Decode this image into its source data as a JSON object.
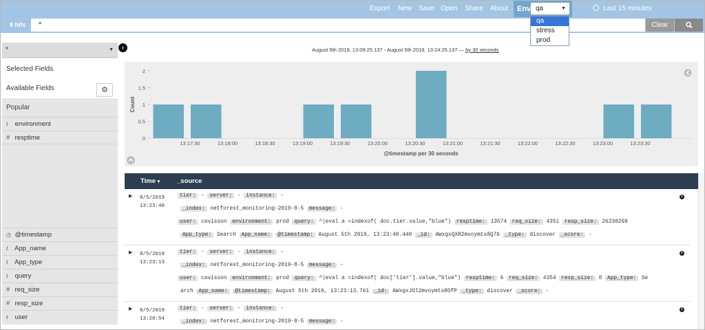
{
  "topnav": {
    "items": [
      "Export",
      "New",
      "Save",
      "Open",
      "Share",
      "About"
    ],
    "env_tab_label": "Env",
    "env_selected": "qa",
    "env_options": [
      "qa",
      "stress",
      "prod"
    ],
    "time_label": "Last 15 minutes"
  },
  "search": {
    "hits": "8 hits",
    "query": "*",
    "clear_label": "Clear"
  },
  "sidebar": {
    "index_pattern": "*",
    "selected_fields_label": "Selected Fields",
    "available_fields_label": "Available Fields",
    "popular_label": "Popular",
    "popular_fields": [
      {
        "type": "t",
        "name": "environment"
      },
      {
        "type": "#",
        "name": "resptime"
      }
    ],
    "fields": [
      {
        "type": "clock",
        "name": "@timestamp"
      },
      {
        "type": "t",
        "name": "App_name"
      },
      {
        "type": "t",
        "name": "App_type"
      },
      {
        "type": "t",
        "name": "query"
      },
      {
        "type": "#",
        "name": "req_size"
      },
      {
        "type": "#",
        "name": "resp_size"
      },
      {
        "type": "t",
        "name": "user"
      }
    ]
  },
  "range": {
    "text": "August 5th 2019, 13:09:25.137 - August 5th 2019, 13:24:25.137 —",
    "interval_link": "by 30 seconds"
  },
  "chart_data": {
    "type": "bar",
    "ylabel": "Count",
    "xlabel": "@timestamp per 30 seconds",
    "ylim": [
      0,
      2
    ],
    "yticks": [
      "0",
      "0.5",
      "1",
      "1.5",
      "2"
    ],
    "xticks": [
      "13:17:30",
      "13:18:00",
      "13:18:30",
      "13:19:00",
      "13:19:30",
      "13:20:00",
      "13:20:30",
      "13:21:00",
      "13:21:30",
      "13:22:00",
      "13:22:30",
      "13:23:00",
      "13:23:30"
    ],
    "bars": [
      {
        "x": "13:17:00",
        "value": 1
      },
      {
        "x": "13:17:30",
        "value": 1
      },
      {
        "x": "13:19:00",
        "value": 1
      },
      {
        "x": "13:19:30",
        "value": 1
      },
      {
        "x": "13:20:30",
        "value": 2
      },
      {
        "x": "13:23:00",
        "value": 1
      },
      {
        "x": "13:23:30",
        "value": 1
      }
    ],
    "color": "#6eacc2"
  },
  "table": {
    "col_time": "Time",
    "col_source": "_source",
    "rows": [
      {
        "date": "8/5/2019",
        "time": "13:23:40",
        "lines": [
          [
            [
              "tier:",
              "-"
            ],
            [
              "server:",
              "-"
            ],
            [
              "instance:",
              "-"
            ]
          ],
          [
            [
              "_index:",
              "netforest_monitoring-2019-8-5"
            ],
            [
              "message:",
              "-"
            ]
          ],
          [
            [
              "user:",
              "cavisson"
            ],
            [
              "environment:",
              "prod"
            ],
            [
              "query:",
              "^|eval a =indexof( doc.tier.value,\"blue\")"
            ],
            [
              "resptime:",
              "13574"
            ],
            [
              "req_size:",
              "4351"
            ],
            [
              "resp_size:",
              "26230269"
            ]
          ],
          [
            [
              "App_type:",
              "Search"
            ],
            [
              "App_name:",
              ""
            ],
            [
              "@timestamp:",
              "August 5th 2019, 13:23:40.440"
            ],
            [
              "_id:",
              "AWxgxQXR2mvoymts8Q76"
            ],
            [
              "_type:",
              "discover"
            ],
            [
              "_score:",
              "-"
            ]
          ]
        ]
      },
      {
        "date": "8/5/2019",
        "time": "13:23:13",
        "lines": [
          [
            [
              "tier:",
              "-"
            ],
            [
              "server:",
              "-"
            ],
            [
              "instance:",
              "-"
            ]
          ],
          [
            [
              "_index:",
              "netforest_monitoring-2019-8-5"
            ],
            [
              "message:",
              "-"
            ]
          ],
          [
            [
              "user:",
              "cavisson"
            ],
            [
              "environment:",
              "prod"
            ],
            [
              "query:",
              "^|eval a =indexof( doc['tier'].value,\"blue\")"
            ],
            [
              "resptime:",
              "6"
            ],
            [
              "req_size:",
              "4354"
            ],
            [
              "resp_size:",
              "0"
            ],
            [
              "App_type:",
              "Se"
            ]
          ],
          [
            [
              "",
              "arch"
            ],
            [
              "App_name:",
              ""
            ],
            [
              "@timestamp:",
              "August 5th 2019, 13:23:13.761"
            ],
            [
              "_id:",
              "AWxgxJOl2mvoymts8OfP"
            ],
            [
              "_type:",
              "discover"
            ],
            [
              "_score:",
              "-"
            ]
          ]
        ]
      },
      {
        "date": "8/5/2019",
        "time": "13:20:54",
        "lines": [
          [
            [
              "tier:",
              "-"
            ],
            [
              "server:",
              "-"
            ],
            [
              "instance:",
              "-"
            ]
          ],
          [
            [
              "_index:",
              "netforest_monitoring-2019-8-5"
            ],
            [
              "message:",
              "-"
            ]
          ]
        ]
      }
    ]
  }
}
